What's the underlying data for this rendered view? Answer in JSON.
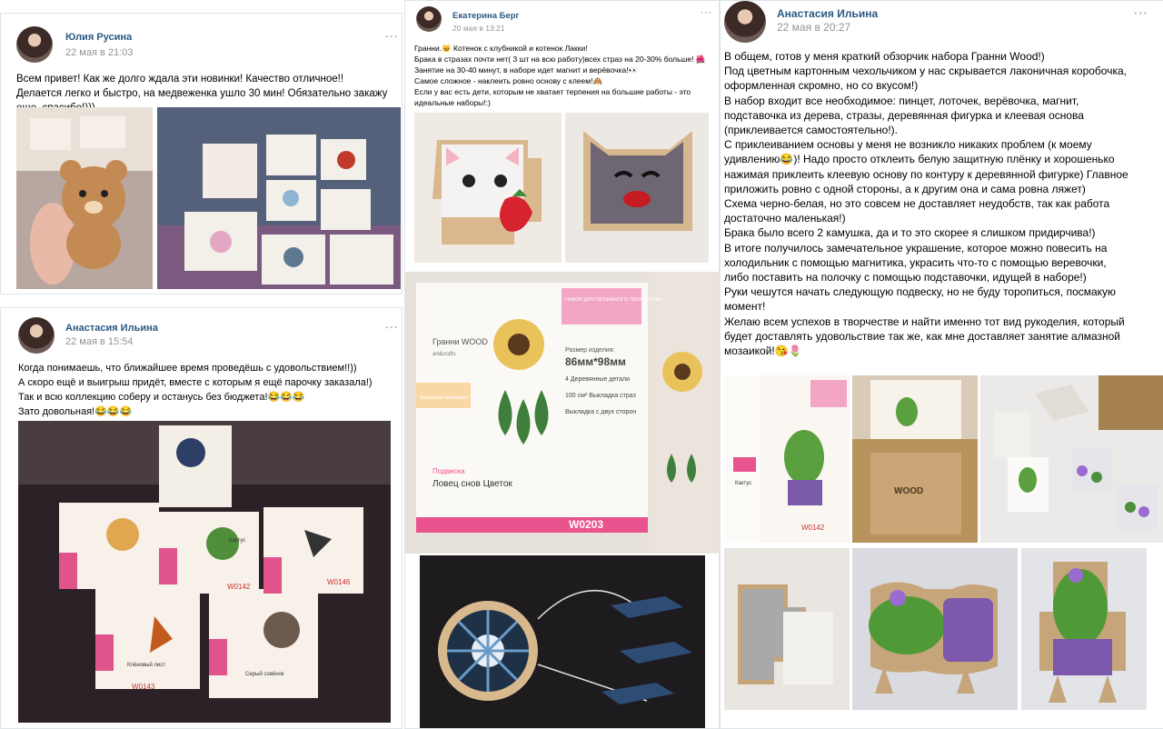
{
  "posts": [
    {
      "author": "Юлия Русина",
      "date": "22 мая в 21:03",
      "text": "Всем привет! Как же долго ждала эти новинки! Качество отличное!! Делается легко и быстро, на медвеженка ушло 30 мин! Обязательно закажу еще, спасибо!)))"
    },
    {
      "author": "Анастасия Ильина",
      "date": "22 мая в 15:54",
      "text": "Когда понимаешь, что ближайшее время проведёшь с удовольствием!!))\nА скоро ещё и выигрыш придёт, вместе с которым я ещё парочку заказала!)\nТак и всю коллекцию соберу и останусь без бюджета!😂😂😂\nЗато довольная!😂😂😂",
      "photo_labels": [
        "Кактус",
        "Клёновый лист",
        "Серый совёнок",
        "W0142",
        "W0143",
        "W0146"
      ]
    },
    {
      "author": "Екатерина Берг",
      "date": "20 мая в 13:21",
      "text": "Гранни.🐱 Котенок с клубникой и котенок Лакки!\nБрака в стразах почти нет( 3 шт на всю работу)всех страз на 20-30% больше! 🌺\nЗанятие на 30-40 минут, в наборе идет магнит и верёвочка!👀\nСамое сложное - наклеить ровно основу с клеем!🙈\nЕсли у вас есть дети, которым не хватает терпения на большие работы - это идеальные наборы!:)",
      "product": {
        "brand": "Гранни WOOD",
        "subbrand": "art&crafts",
        "kit_label": "НАБОР ДЛЯ ОБЪЕМНОГО ТВОРЧЕСТВА",
        "size_label": "Размер изделия:",
        "size": "86мм*98мм",
        "parts": "4 Деревянные детали",
        "stones": "100 см² Выкладка страз",
        "sides": "Выкладка с двух сторон",
        "tagline": "алмазная мозаика+ дерево",
        "type": "Подвеска",
        "name": "Ловец снов Цветок",
        "code": "W0203"
      }
    },
    {
      "author": "Анастасия Ильина",
      "date": "22 мая в 20:27",
      "text": "В общем, готов у меня краткий обзорчик набора Гранни Wood!)\nПод цветным картонным чехольчиком у нас скрывается лаконичная коробочка, оформленная скромно, но со вкусом!)\nВ набор входит все необходимое: пинцет, лоточек, верёвочка, магнит, подставочка из дерева, стразы, деревянная фигурка и клеевая основа (приклеивается самостоятельно!).\nС приклеиванием основы у меня не возникло никаких проблем (к моему удивлению😂)! Надо просто отклеить белую защитную плёнку и хорошенько нажимая приклеить клеевую основу по контуру к деревянной фигурке) Главное приложить ровно с одной стороны, а к другим она и сама ровна ляжет)\nСхема черно-белая, но это совсем не доставляет неудобств, так как работа достаточно маленькая!)\nБрака было всего 2 камушка, да и то это скорее я слишком придирчива!)\nВ итоге получилось замечательное украшение, которое можно повесить на холодильник с помощью магнитика, украсить что-то с помощью веревочки, либо поставить на полочку с помощью подставочки, идущей в наборе!)\nРуки чешутся начать следующую подвеску, но не буду торопиться, посмакую момент!\nЖелаю всем успехов в творчестве и найти именно тот вид рукоделия, который будет доставлять удовольствие так же, как мне доставляет занятие алмазной мозаикой!😘🌷",
      "photo_labels": [
        "Кактус",
        "W0142",
        "WOOD"
      ]
    }
  ],
  "menu_glyph": "···",
  "colors": {
    "author": "#2a5885",
    "date": "#939393",
    "border": "#dfe3e8"
  }
}
